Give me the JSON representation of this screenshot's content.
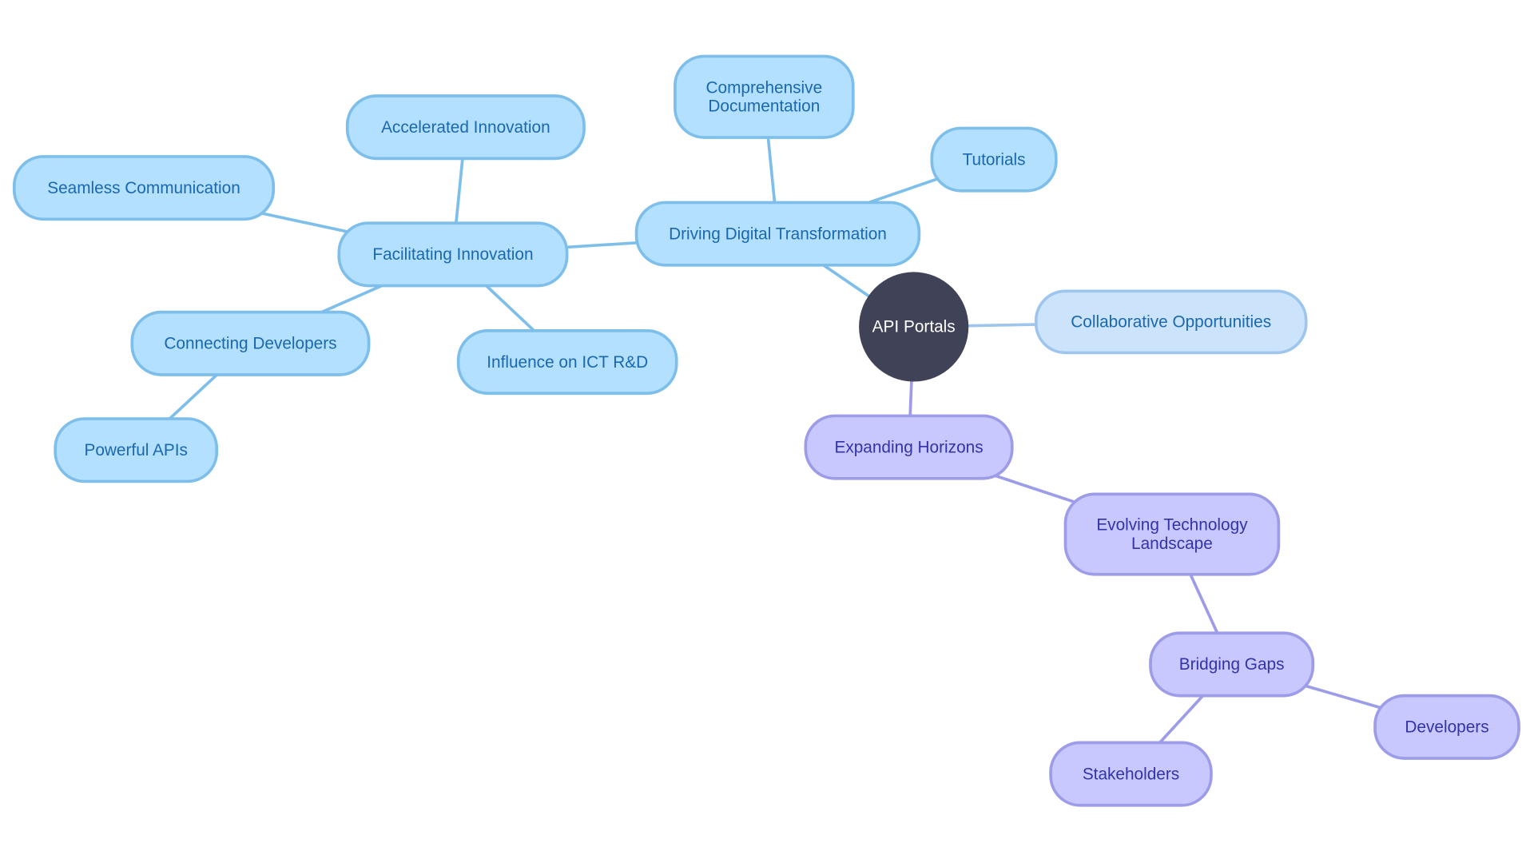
{
  "colors": {
    "root_fill": "#404258",
    "root_text": "#ffffff",
    "blue_fill": "#b3e0ff",
    "blue_stroke": "#7dbeea",
    "blue_text": "#1a68ad",
    "light_fill": "#cce4fb",
    "light_stroke": "#9ec5ee",
    "light_text": "#1a68ad",
    "purple_fill": "#c8c8ff",
    "purple_stroke": "#9c9ce8",
    "purple_text": "#3333a8"
  },
  "nodes": [
    {
      "id": "root",
      "label": [
        "API Portals"
      ],
      "parent": null,
      "style": "root"
    },
    {
      "id": "collab",
      "label": [
        "Collaborative Opportunities"
      ],
      "parent": "root",
      "style": "light"
    },
    {
      "id": "driving",
      "label": [
        "Driving Digital Transformation"
      ],
      "parent": "root",
      "style": "blue"
    },
    {
      "id": "docs",
      "label": [
        "Comprehensive",
        "Documentation"
      ],
      "parent": "driving",
      "style": "blue"
    },
    {
      "id": "tutorials",
      "label": [
        "Tutorials"
      ],
      "parent": "driving",
      "style": "blue"
    },
    {
      "id": "facilitating",
      "label": [
        "Facilitating Innovation"
      ],
      "parent": "driving",
      "style": "blue"
    },
    {
      "id": "accelerated",
      "label": [
        "Accelerated Innovation"
      ],
      "parent": "facilitating",
      "style": "blue"
    },
    {
      "id": "seamless",
      "label": [
        "Seamless Communication"
      ],
      "parent": "facilitating",
      "style": "blue"
    },
    {
      "id": "connecting",
      "label": [
        "Connecting Developers"
      ],
      "parent": "facilitating",
      "style": "blue"
    },
    {
      "id": "powerful",
      "label": [
        "Powerful APIs"
      ],
      "parent": "connecting",
      "style": "blue"
    },
    {
      "id": "influence",
      "label": [
        "Influence on ICT R&D"
      ],
      "parent": "facilitating",
      "style": "blue"
    },
    {
      "id": "expanding",
      "label": [
        "Expanding Horizons"
      ],
      "parent": "root",
      "style": "purple"
    },
    {
      "id": "evolving",
      "label": [
        "Evolving Technology",
        "Landscape"
      ],
      "parent": "expanding",
      "style": "purple"
    },
    {
      "id": "bridging",
      "label": [
        "Bridging Gaps"
      ],
      "parent": "evolving",
      "style": "purple"
    },
    {
      "id": "developers",
      "label": [
        "Developers"
      ],
      "parent": "bridging",
      "style": "purple"
    },
    {
      "id": "stakeholders",
      "label": [
        "Stakeholders"
      ],
      "parent": "bridging",
      "style": "purple"
    }
  ]
}
